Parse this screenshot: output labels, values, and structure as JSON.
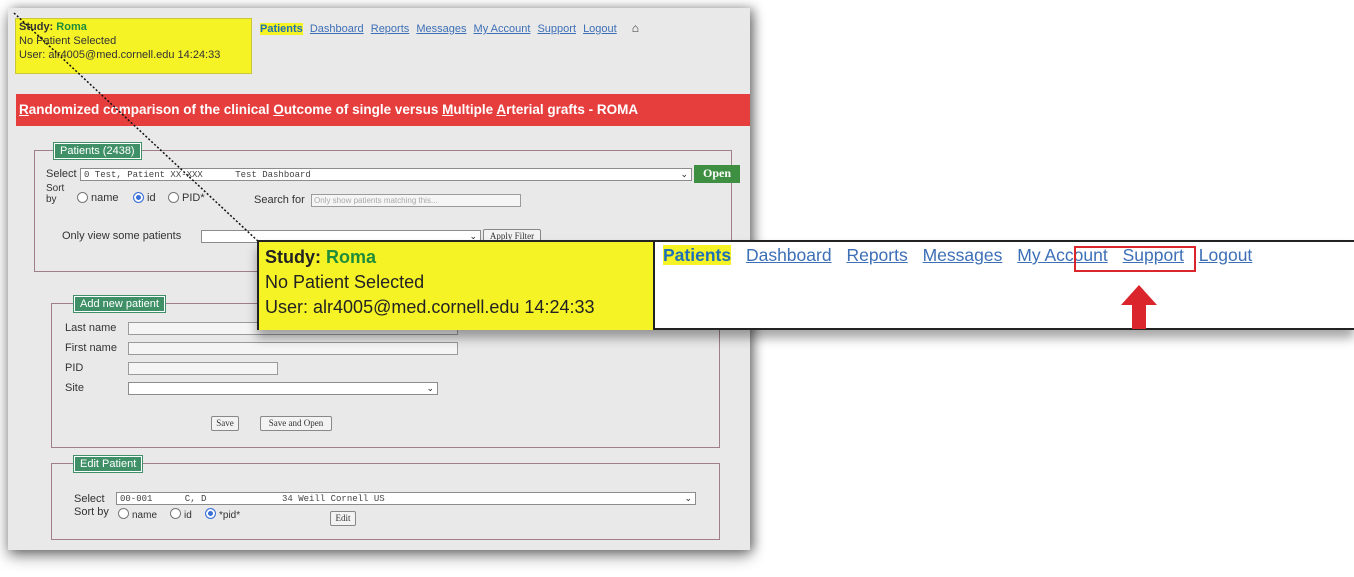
{
  "header": {
    "study_label": "Study:",
    "study_name": "Roma",
    "patient_status": "No Patient Selected",
    "user_label": "User:",
    "user_value": "alr4005@med.cornell.edu 14:24:33"
  },
  "nav": {
    "items": [
      "Patients",
      "Dashboard",
      "Reports",
      "Messages",
      "My Account",
      "Support",
      "Logout"
    ],
    "active": "Patients",
    "home_icon": "home-icon"
  },
  "banner": {
    "title_parts": [
      "R",
      "andomized comparison of the clinical ",
      "O",
      "utcome of single versus ",
      "M",
      "ultiple ",
      "A",
      "rterial grafts - ROMA"
    ]
  },
  "patients_box": {
    "legend": "Patients (2438)",
    "select_label": "Select",
    "select_value": "0 Test, Patient XX-XXX      Test Dashboard",
    "open_button": "Open",
    "sort_label": "Sort by",
    "sort_options": [
      "name",
      "id",
      "PID*"
    ],
    "sort_selected": "id",
    "search_label": "Search for",
    "search_placeholder": "Only show patients matching this...",
    "filter_label": "Only view some patients",
    "apply_filter_button": "Apply Filter"
  },
  "add_box": {
    "legend": "Add new patient",
    "fields": [
      "Last name",
      "First name",
      "PID",
      "Site"
    ],
    "save_button": "Save",
    "save_open_button": "Save and Open"
  },
  "edit_box": {
    "legend": "Edit Patient",
    "select_label": "Select",
    "select_value": "00-001      C, D              34 Weill Cornell US",
    "sort_label": "Sort by",
    "sort_options": [
      "name",
      "id",
      "*pid*"
    ],
    "sort_selected": "*pid*",
    "edit_button": "Edit"
  },
  "colors": {
    "banner": "#e63d3d",
    "highlight_yellow": "#f5f226",
    "legend_green": "#3f8f67",
    "open_green": "#3f8f43",
    "callout_red": "#d9252b"
  }
}
